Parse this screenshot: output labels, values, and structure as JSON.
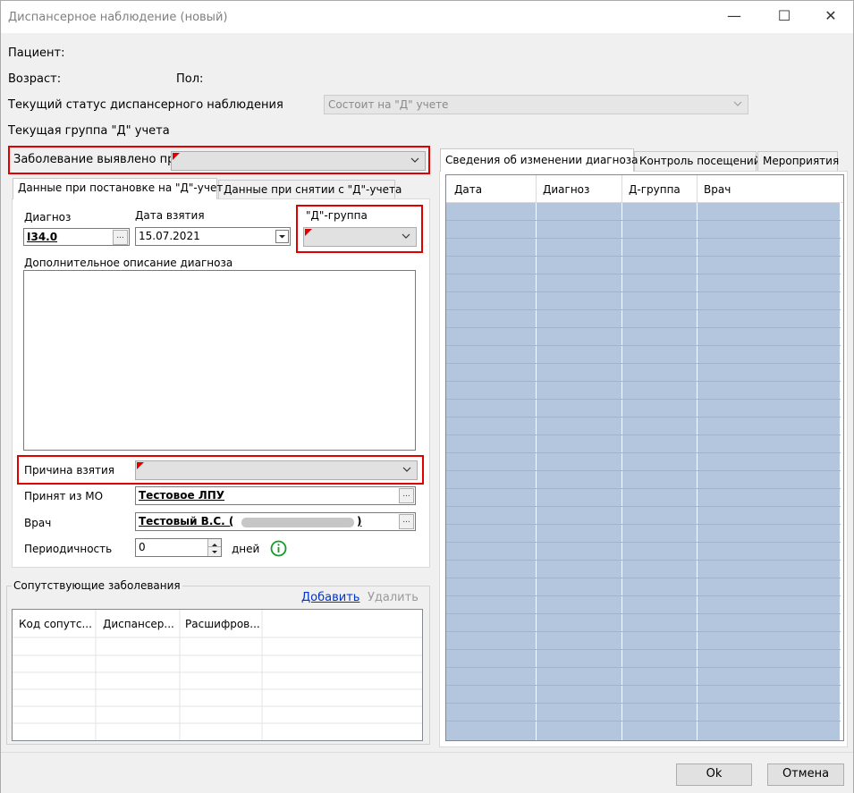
{
  "window": {
    "title": "Диспансерное наблюдение (новый)",
    "minimize": "—",
    "maximize": "☐",
    "close": "✕"
  },
  "header": {
    "patient_label": "Пациент:",
    "age_label": "Возраст:",
    "sex_label": "Пол:",
    "status_label": "Текущий статус диспансерного наблюдения",
    "status_value": "Состоит на \"Д\" учете",
    "group_label": "Текущая группа \"Д\" учета",
    "detected_label": "Заболевание выявлено при",
    "detected_value": ""
  },
  "left_tabs": {
    "tab1": "Данные при постановке на \"Д\"-учет",
    "tab2": "Данные при снятии с \"Д\"-учета"
  },
  "form": {
    "diagnosis_label": "Диагноз",
    "diagnosis_value": "I34.0",
    "date_label": "Дата взятия",
    "date_value": "15.07.2021",
    "dgroup_label": "\"Д\"-группа",
    "dgroup_value": "",
    "desc_label": "Дополнительное описание диагноза",
    "desc_value": "",
    "reason_label": "Причина взятия",
    "reason_value": "",
    "from_mo_label": "Принят из МО",
    "from_mo_value": "Тестовое ЛПУ",
    "doctor_label": "Врач",
    "doctor_value_prefix": "Тестовый В.С. (",
    "doctor_value_suffix": ")",
    "period_label": "Периодичность",
    "period_value": "0",
    "period_unit": "дней",
    "ellipsis": "..."
  },
  "comorbid": {
    "title": "Сопутствующие заболевания",
    "add": "Добавить",
    "delete": "Удалить",
    "columns": [
      "Код сопутс...",
      "Диспансер...",
      "Расшифров..."
    ]
  },
  "right_tabs": {
    "tab1": "Сведения об изменении диагноза",
    "tab2": "Контроль посещений",
    "tab3": "Мероприятия"
  },
  "history": {
    "columns": [
      "Дата",
      "Диагноз",
      "Д-группа",
      "Врач"
    ]
  },
  "footer": {
    "ok": "Ok",
    "cancel": "Отмена"
  },
  "colors": {
    "grid_fill": "#b3c6de",
    "required_marker": "#e00000",
    "highlight": "#e00000"
  }
}
